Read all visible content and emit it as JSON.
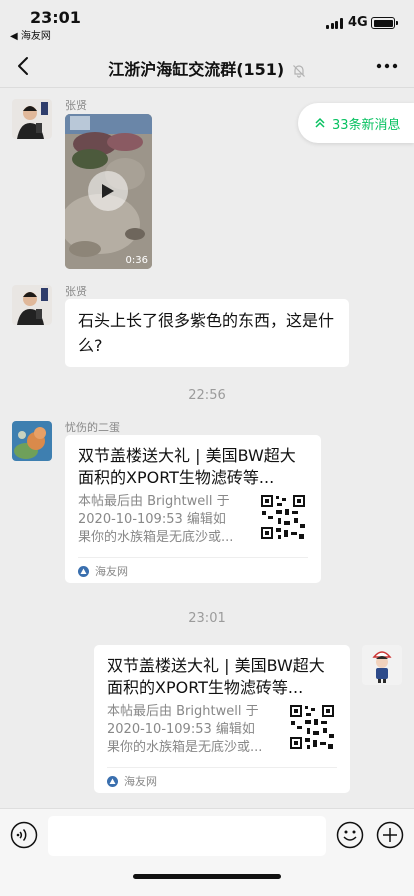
{
  "status_bar": {
    "time": "23:01",
    "back_app": "◀ 海友网",
    "network": "4G"
  },
  "nav": {
    "title": "江浙沪海缸交流群(151)",
    "back_icon": "chevron-left-icon",
    "more_icon": "more-dots-icon",
    "mute_icon": "bell-off-icon"
  },
  "new_messages": {
    "label": "33条新消息",
    "icon": "double-chevron-up-icon"
  },
  "messages": [
    {
      "sender": "张贤",
      "type": "video",
      "duration": "0:36"
    },
    {
      "sender": "张贤",
      "type": "text",
      "text": "石头上长了很多紫色的东西，这是什么?"
    },
    {
      "type": "timestamp",
      "text": "22:56"
    },
    {
      "sender": "忧伤的二蛋",
      "type": "link_card",
      "title": "双节盖楼送大礼 | 美国BW超大面积的XPORT生物滤砖等...",
      "desc": "本帖最后由 Brightwell 于 2020-10-109:53 编辑如果你的水族箱是无底沙或...",
      "source": "海友网"
    },
    {
      "type": "timestamp",
      "text": "23:01"
    },
    {
      "sender": "me",
      "type": "link_card",
      "title": "双节盖楼送大礼 | 美国BW超大面积的XPORT生物滤砖等...",
      "desc": "本帖最后由 Brightwell 于 2020-10-109:53 编辑如果你的水族箱是无底沙或...",
      "source": "海友网"
    }
  ],
  "input_bar": {
    "voice_icon": "voice-icon",
    "emoji_icon": "emoji-icon",
    "plus_icon": "plus-circle-icon"
  },
  "colors": {
    "accent": "#07c160",
    "background": "#ededed",
    "bubble": "#ffffff"
  }
}
